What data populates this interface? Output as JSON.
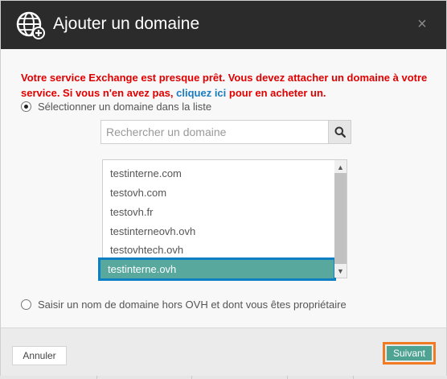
{
  "dialog": {
    "title": "Ajouter un domaine",
    "close_icon": "close-icon",
    "header_icon": "globe-add-icon"
  },
  "message": {
    "part1": "Votre service Exchange est presque prêt. Vous devez attacher un domaine à votre service. Si vous n'en avez pas, ",
    "link": "cliquez ici",
    "part2": " pour en acheter un."
  },
  "option_list": {
    "label": "Sélectionner un domaine dans la liste",
    "checked": true
  },
  "search": {
    "placeholder": "Rechercher un domaine",
    "value": "",
    "icon": "search-icon"
  },
  "domains": {
    "items": [
      "testinterne.com",
      "testovh.com",
      "testovh.fr",
      "testinterneovh.ovh",
      "testovhtech.ovh",
      "testinterne.ovh"
    ],
    "selected": "testinterne.ovh"
  },
  "option_other": {
    "label": "Saisir un nom de domaine hors OVH et dont vous êtes propriétaire",
    "checked": false
  },
  "footer": {
    "cancel_label": "Annuler",
    "next_label": "Suivant"
  },
  "colors": {
    "header_bg": "#2b2b2b",
    "error_text": "#e00000",
    "link": "#1a7bbf",
    "selected_item": "#58a89e",
    "primary_button": "#4fa393",
    "highlight_border": "#f07b22"
  }
}
